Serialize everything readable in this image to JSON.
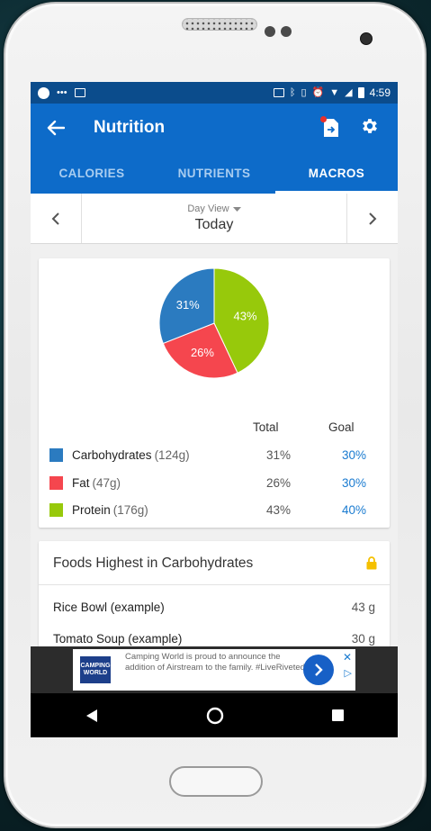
{
  "statusbar": {
    "time": "4:59"
  },
  "appbar": {
    "title": "Nutrition"
  },
  "tabs": [
    {
      "label": "CALORIES",
      "active": false
    },
    {
      "label": "NUTRIENTS",
      "active": false
    },
    {
      "label": "MACROS",
      "active": true
    }
  ],
  "dayview": {
    "label": "Day View",
    "value": "Today"
  },
  "macros": {
    "total_header": "Total",
    "goal_header": "Goal",
    "rows": [
      {
        "name": "Carbohydrates",
        "grams": "(124g)",
        "total": "31%",
        "goal": "30%",
        "color": "#2b7bc0"
      },
      {
        "name": "Fat",
        "grams": "(47g)",
        "total": "26%",
        "goal": "30%",
        "color": "#f5464e"
      },
      {
        "name": "Protein",
        "grams": "(176g)",
        "total": "43%",
        "goal": "40%",
        "color": "#97c90b"
      }
    ]
  },
  "chart_data": {
    "type": "pie",
    "categories": [
      "Carbohydrates",
      "Fat",
      "Protein"
    ],
    "values": [
      31,
      26,
      43
    ],
    "labels": [
      "31%",
      "26%",
      "43%"
    ],
    "colors": [
      "#2b7bc0",
      "#f5464e",
      "#97c90b"
    ]
  },
  "foods": {
    "title": "Foods Highest in Carbohydrates",
    "items": [
      {
        "name": "Rice Bowl (example)",
        "amount": "43 g"
      },
      {
        "name": "Tomato Soup (example)",
        "amount": "30 g"
      }
    ]
  },
  "ad": {
    "logo": "CAMPING WORLD",
    "text": "Camping World is proud to announce the addition of Airstream to the family. #LiveRiveted"
  }
}
